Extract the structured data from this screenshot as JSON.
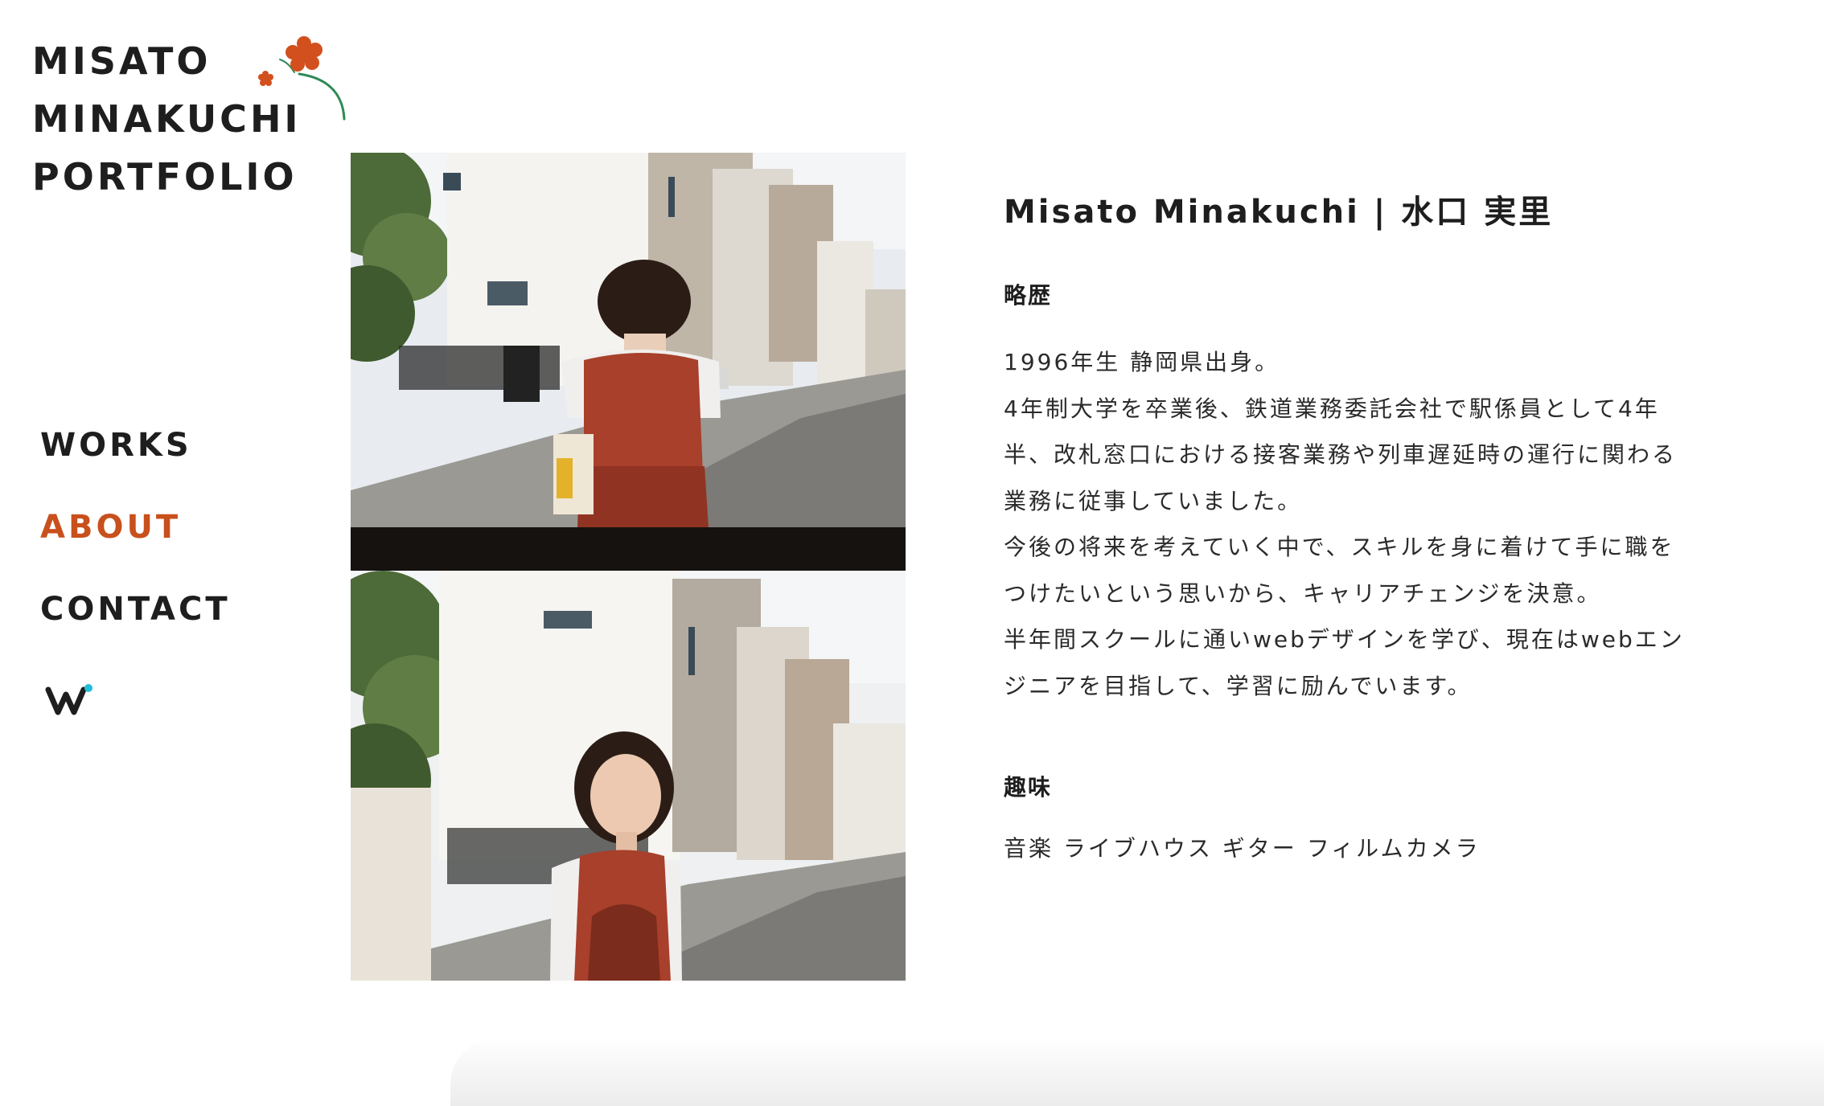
{
  "logo": {
    "lines": [
      "MISATO",
      "MINAKUCHI",
      "PORTFOLIO"
    ],
    "flower_color": "#d2501e",
    "stem_color": "#2e8a57"
  },
  "nav": {
    "items": [
      {
        "label": "WORKS"
      },
      {
        "label": "ABOUT"
      },
      {
        "label": "CONTACT"
      }
    ],
    "active_color": "#c8501c",
    "social_icon": "wantedly-icon"
  },
  "profile": {
    "name": "Misato Minakuchi | 水口 実里",
    "career_heading": "略歴",
    "career_lines": [
      "1996年生 静岡県出身。",
      "4年制大学を卒業後、鉄道業務委託会社で駅係員として4年",
      "半、改札窓口における接客業務や列車遅延時の運行に関わる",
      "業務に従事していました。",
      "今後の将来を考えていく中で、スキルを身に着けて手に職を",
      "つけたいという思いから、キャリアチェンジを決意。",
      "半年間スクールに通いwebデザインを学び、現在はwebエン",
      "ジニアを目指して、学習に励んでいます。"
    ],
    "hobby_heading": "趣味",
    "hobby_text": "音楽 ライブハウス ギター フィルムカメラ"
  }
}
